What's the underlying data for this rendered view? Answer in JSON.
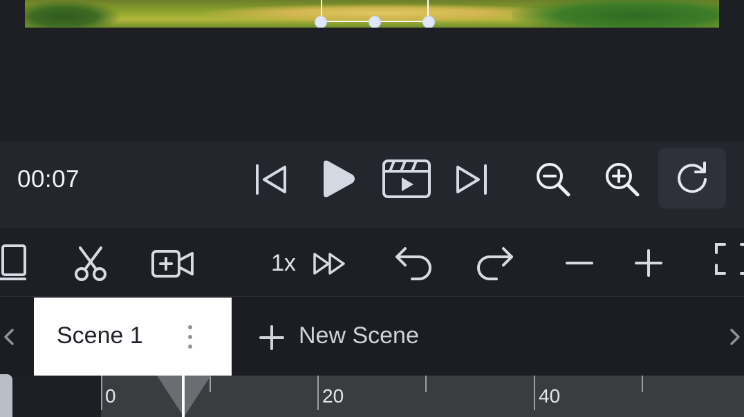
{
  "playback": {
    "timecode": "00:07",
    "icons": [
      "skip-to-start-icon",
      "play-icon",
      "clapperboard-icon",
      "skip-to-end-icon",
      "zoom-out-icon",
      "zoom-in-icon",
      "refresh-icon"
    ]
  },
  "toolbar": {
    "speed_label": "1x",
    "icons": [
      "page-icon",
      "scissors-icon",
      "add-video-icon",
      "fast-forward-icon",
      "undo-icon",
      "redo-icon",
      "minus-icon",
      "plus-icon",
      "fullscreen-icon"
    ]
  },
  "scenes": {
    "tabs": [
      {
        "label": "Scene 1",
        "active": true
      }
    ],
    "new_scene_label": "New Scene"
  },
  "timeline": {
    "ticks": [
      "0",
      "20",
      "40"
    ]
  },
  "colors": {
    "background": "#1d1f24",
    "playback_bar": "#23262d",
    "active_tab": "#ffffff",
    "selection_handle": "#dfe6ff",
    "ruler": "#3a3c40"
  }
}
